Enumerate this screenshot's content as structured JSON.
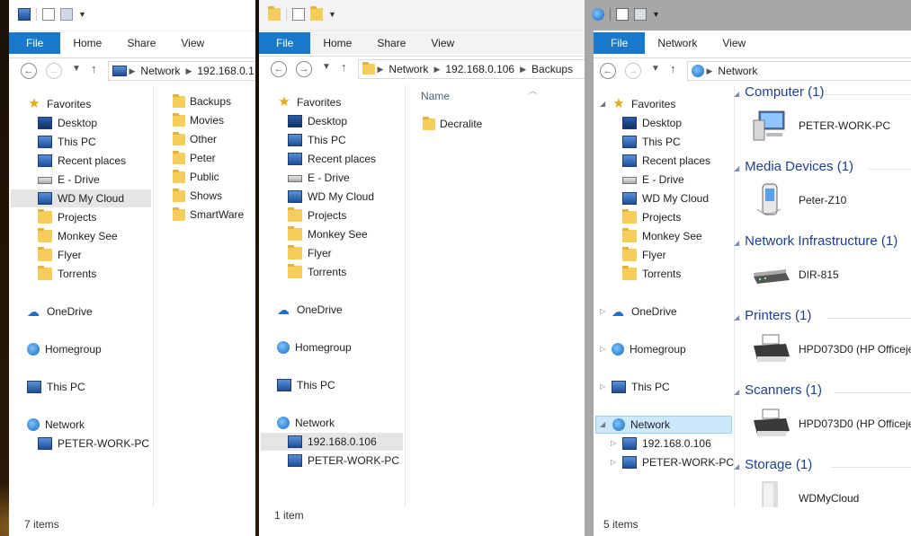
{
  "windows": [
    {
      "ribbon": {
        "file": "File",
        "tabs": [
          "Home",
          "Share",
          "View"
        ]
      },
      "address": [
        "Network",
        "192.168.0.1"
      ],
      "nav": [
        {
          "label": "Favorites",
          "icon": "star-icon",
          "kind": "star"
        },
        {
          "label": "Desktop",
          "icon": "desktop-icon",
          "kind": "pcscr"
        },
        {
          "label": "This PC",
          "icon": "computer-icon",
          "kind": "pc"
        },
        {
          "label": "Recent places",
          "icon": "recent-places-icon",
          "kind": "pc"
        },
        {
          "label": "E - Drive",
          "icon": "drive-icon",
          "kind": "drive"
        },
        {
          "label": "WD My Cloud",
          "icon": "network-drive-icon",
          "kind": "pc"
        },
        {
          "label": "Projects",
          "icon": "folder-icon",
          "kind": "folder"
        },
        {
          "label": "Monkey See",
          "icon": "folder-icon",
          "kind": "folder"
        },
        {
          "label": "Flyer",
          "icon": "folder-icon",
          "kind": "folder"
        },
        {
          "label": "Torrents",
          "icon": "folder-icon",
          "kind": "folder"
        },
        {
          "label": "OneDrive",
          "icon": "onedrive-icon",
          "kind": "cloud"
        },
        {
          "label": "Homegroup",
          "icon": "homegroup-icon",
          "kind": "globe"
        },
        {
          "label": "This PC",
          "icon": "computer-icon",
          "kind": "pc"
        },
        {
          "label": "Network",
          "icon": "network-icon",
          "kind": "globe"
        },
        {
          "label": "PETER-WORK-PC",
          "icon": "computer-icon",
          "kind": "pc"
        }
      ],
      "content": [
        "Backups",
        "Movies",
        "Other",
        "Peter",
        "Public",
        "Shows",
        "SmartWare"
      ],
      "status": "7 items"
    },
    {
      "ribbon": {
        "file": "File",
        "tabs": [
          "Home",
          "Share",
          "View"
        ]
      },
      "address": [
        "Network",
        "192.168.0.106",
        "Backups"
      ],
      "nav": [
        {
          "label": "Favorites",
          "icon": "star-icon",
          "kind": "star"
        },
        {
          "label": "Desktop",
          "icon": "desktop-icon",
          "kind": "pcscr"
        },
        {
          "label": "This PC",
          "icon": "computer-icon",
          "kind": "pc"
        },
        {
          "label": "Recent places",
          "icon": "recent-places-icon",
          "kind": "pc"
        },
        {
          "label": "E - Drive",
          "icon": "drive-icon",
          "kind": "drive"
        },
        {
          "label": "WD My Cloud",
          "icon": "network-drive-icon",
          "kind": "pc"
        },
        {
          "label": "Projects",
          "icon": "folder-icon",
          "kind": "folder"
        },
        {
          "label": "Monkey See",
          "icon": "folder-icon",
          "kind": "folder"
        },
        {
          "label": "Flyer",
          "icon": "folder-icon",
          "kind": "folder"
        },
        {
          "label": "Torrents",
          "icon": "folder-icon",
          "kind": "folder"
        },
        {
          "label": "OneDrive",
          "icon": "onedrive-icon",
          "kind": "cloud"
        },
        {
          "label": "Homegroup",
          "icon": "homegroup-icon",
          "kind": "globe"
        },
        {
          "label": "This PC",
          "icon": "computer-icon",
          "kind": "pc"
        },
        {
          "label": "Network",
          "icon": "network-icon",
          "kind": "globe"
        },
        {
          "label": "192.168.0.106",
          "icon": "computer-icon",
          "kind": "pc"
        },
        {
          "label": "PETER-WORK-PC",
          "icon": "computer-icon",
          "kind": "pc"
        }
      ],
      "column_header": "Name",
      "content": [
        "Decralite"
      ],
      "status": "1 item"
    },
    {
      "ribbon": {
        "file": "File",
        "tabs": [
          "Network",
          "View"
        ]
      },
      "address": [
        "Network"
      ],
      "nav": [
        {
          "label": "Favorites",
          "icon": "star-icon",
          "kind": "star"
        },
        {
          "label": "Desktop",
          "icon": "desktop-icon",
          "kind": "pcscr"
        },
        {
          "label": "This PC",
          "icon": "computer-icon",
          "kind": "pc"
        },
        {
          "label": "Recent places",
          "icon": "recent-places-icon",
          "kind": "pc"
        },
        {
          "label": "E - Drive",
          "icon": "drive-icon",
          "kind": "drive"
        },
        {
          "label": "WD My Cloud",
          "icon": "network-drive-icon",
          "kind": "pc"
        },
        {
          "label": "Projects",
          "icon": "folder-icon",
          "kind": "folder"
        },
        {
          "label": "Monkey See",
          "icon": "folder-icon",
          "kind": "folder"
        },
        {
          "label": "Flyer",
          "icon": "folder-icon",
          "kind": "folder"
        },
        {
          "label": "Torrents",
          "icon": "folder-icon",
          "kind": "folder"
        },
        {
          "label": "OneDrive",
          "icon": "onedrive-icon",
          "kind": "cloud"
        },
        {
          "label": "Homegroup",
          "icon": "homegroup-icon",
          "kind": "globe"
        },
        {
          "label": "This PC",
          "icon": "computer-icon",
          "kind": "pc"
        },
        {
          "label": "Network",
          "icon": "network-icon",
          "kind": "globe"
        },
        {
          "label": "192.168.0.106",
          "icon": "computer-icon",
          "kind": "pc"
        },
        {
          "label": "PETER-WORK-PC",
          "icon": "computer-icon",
          "kind": "pc"
        }
      ],
      "groups": [
        {
          "title": "Computer (1)",
          "device": "PETER-WORK-PC",
          "icon": "computer-icon"
        },
        {
          "title": "Media Devices (1)",
          "device": "Peter-Z10",
          "icon": "phone-icon"
        },
        {
          "title": "Network Infrastructure (1)",
          "device": "DIR-815",
          "icon": "router-icon"
        },
        {
          "title": "Printers (1)",
          "device": "HPD073D0 (HP Officejet",
          "icon": "printer-icon"
        },
        {
          "title": "Scanners (1)",
          "device": "HPD073D0 (HP Officejet",
          "icon": "scanner-icon"
        },
        {
          "title": "Storage (1)",
          "device": "WDMyCloud",
          "icon": "storage-icon"
        }
      ],
      "status": "5 items"
    }
  ],
  "colors": {
    "file_tab": "#1979ca",
    "group_title": "#1e3f8f",
    "selection_blue": "#cce8ff"
  }
}
